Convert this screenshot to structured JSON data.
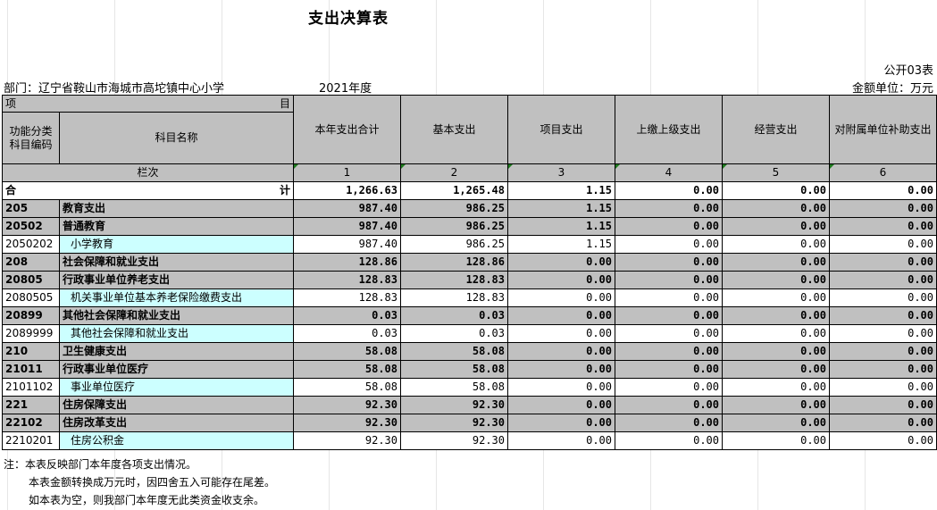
{
  "title": "支出决算表",
  "form_no": "公开03表",
  "department": "部门：辽宁省鞍山市海城市高坨镇中心小学",
  "year": "2021年度",
  "unit": "金额单位：万元",
  "header": {
    "xiang": "项",
    "mu": "目",
    "code_col": "功能分类科目编码",
    "name_col": "科目名称",
    "cols": [
      "本年支出合计",
      "基本支出",
      "项目支出",
      "上缴上级支出",
      "经营支出",
      "对附属单位补助支出"
    ],
    "lanci": "栏次",
    "col_nums": [
      "1",
      "2",
      "3",
      "4",
      "5",
      "6"
    ]
  },
  "total": {
    "label_left": "合",
    "label_right": "计",
    "values": [
      "1,266.63",
      "1,265.48",
      "1.15",
      "0.00",
      "0.00",
      "0.00"
    ]
  },
  "rows": [
    {
      "code": "205",
      "name": "教育支出",
      "level": 1,
      "values": [
        "987.40",
        "986.25",
        "1.15",
        "0.00",
        "0.00",
        "0.00"
      ]
    },
    {
      "code": "20502",
      "name": "普通教育",
      "level": 2,
      "values": [
        "987.40",
        "986.25",
        "1.15",
        "0.00",
        "0.00",
        "0.00"
      ]
    },
    {
      "code": "2050202",
      "name": "小学教育",
      "level": 3,
      "values": [
        "987.40",
        "986.25",
        "1.15",
        "0.00",
        "0.00",
        "0.00"
      ]
    },
    {
      "code": "208",
      "name": "社会保障和就业支出",
      "level": 1,
      "values": [
        "128.86",
        "128.86",
        "0.00",
        "0.00",
        "0.00",
        "0.00"
      ]
    },
    {
      "code": "20805",
      "name": "行政事业单位养老支出",
      "level": 2,
      "values": [
        "128.83",
        "128.83",
        "0.00",
        "0.00",
        "0.00",
        "0.00"
      ]
    },
    {
      "code": "2080505",
      "name": "机关事业单位基本养老保险缴费支出",
      "level": 3,
      "values": [
        "128.83",
        "128.83",
        "0.00",
        "0.00",
        "0.00",
        "0.00"
      ]
    },
    {
      "code": "20899",
      "name": "其他社会保障和就业支出",
      "level": 2,
      "values": [
        "0.03",
        "0.03",
        "0.00",
        "0.00",
        "0.00",
        "0.00"
      ]
    },
    {
      "code": "2089999",
      "name": "其他社会保障和就业支出",
      "level": 3,
      "values": [
        "0.03",
        "0.03",
        "0.00",
        "0.00",
        "0.00",
        "0.00"
      ]
    },
    {
      "code": "210",
      "name": "卫生健康支出",
      "level": 1,
      "values": [
        "58.08",
        "58.08",
        "0.00",
        "0.00",
        "0.00",
        "0.00"
      ]
    },
    {
      "code": "21011",
      "name": "行政事业单位医疗",
      "level": 2,
      "values": [
        "58.08",
        "58.08",
        "0.00",
        "0.00",
        "0.00",
        "0.00"
      ]
    },
    {
      "code": "2101102",
      "name": "事业单位医疗",
      "level": 3,
      "values": [
        "58.08",
        "58.08",
        "0.00",
        "0.00",
        "0.00",
        "0.00"
      ]
    },
    {
      "code": "221",
      "name": "住房保障支出",
      "level": 1,
      "values": [
        "92.30",
        "92.30",
        "0.00",
        "0.00",
        "0.00",
        "0.00"
      ]
    },
    {
      "code": "22102",
      "name": "住房改革支出",
      "level": 2,
      "values": [
        "92.30",
        "92.30",
        "0.00",
        "0.00",
        "0.00",
        "0.00"
      ]
    },
    {
      "code": "2210201",
      "name": "住房公积金",
      "level": 3,
      "values": [
        "92.30",
        "92.30",
        "0.00",
        "0.00",
        "0.00",
        "0.00"
      ]
    }
  ],
  "notes": [
    "注：本表反映部门本年度各项支出情况。",
    "本表金额转换成万元时，因四舍五入可能存在尾差。",
    "如本表为空，则我部门本年度无此类资金收支余。"
  ],
  "colors": {
    "header_bg": "#c0c0c0",
    "leaf_name_bg": "#ccffff",
    "marker": "#1e7b1e"
  }
}
